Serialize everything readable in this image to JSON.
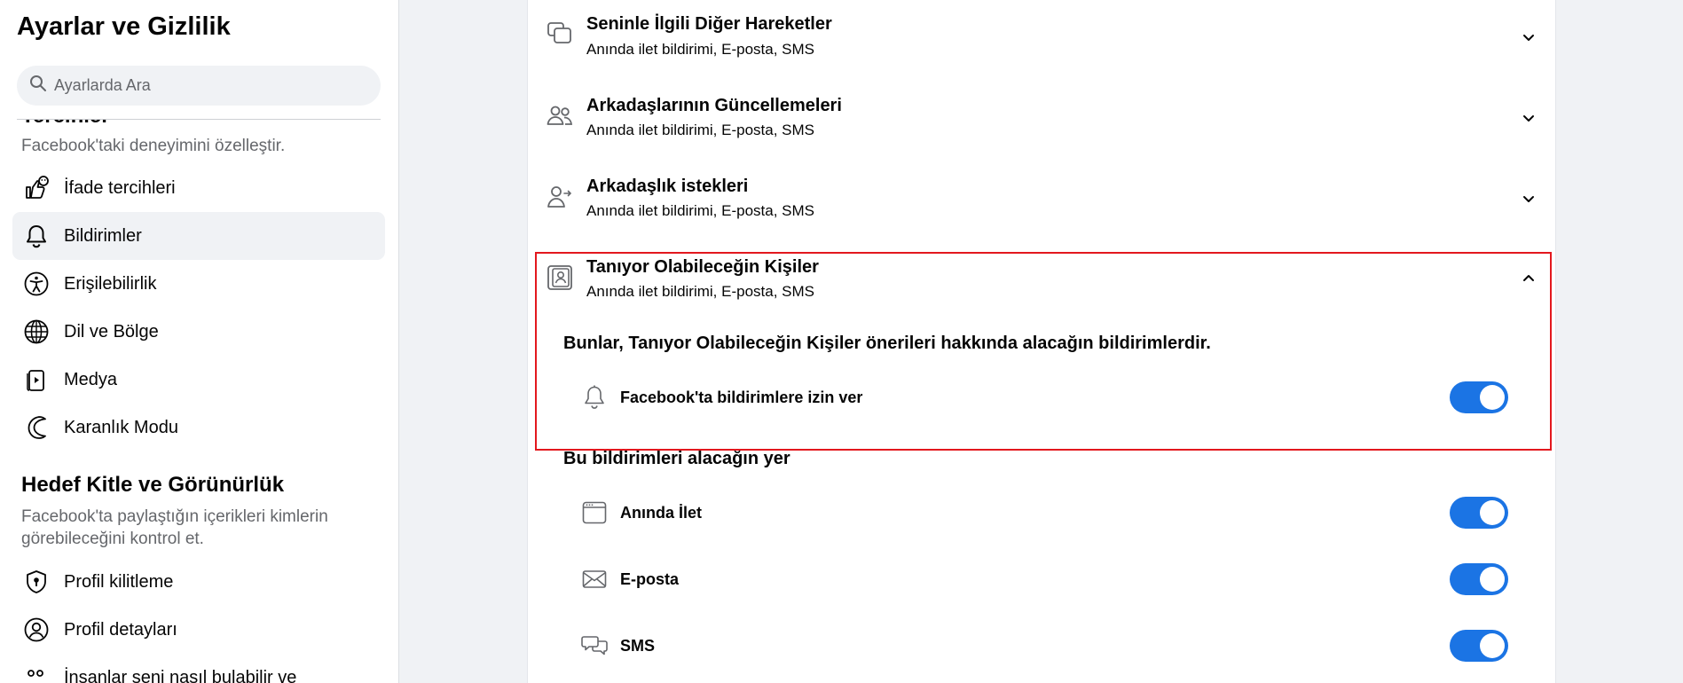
{
  "sidebar": {
    "title": "Ayarlar ve Gizlilik",
    "search_placeholder": "Ayarlarda Ara",
    "prefs_heading_partial": "Tercihler",
    "prefs_desc": "Facebook'taki deneyimini özelleştir.",
    "prefs_items": [
      {
        "label": "İfade tercihleri",
        "icon": "reactions-icon"
      },
      {
        "label": "Bildirimler",
        "icon": "bell-icon",
        "active": true
      },
      {
        "label": "Erişilebilirlik",
        "icon": "accessibility-icon"
      },
      {
        "label": "Dil ve Bölge",
        "icon": "globe-icon"
      },
      {
        "label": "Medya",
        "icon": "media-icon"
      },
      {
        "label": "Karanlık Modu",
        "icon": "moon-icon"
      }
    ],
    "audience_heading": "Hedef Kitle ve Görünürlük",
    "audience_desc": "Facebook'ta paylaştığın içerikleri kimlerin görebileceğini kontrol et.",
    "audience_items": [
      {
        "label": "Profil kilitleme",
        "icon": "shield-lock-icon"
      },
      {
        "label": "Profil detayları",
        "icon": "profile-icon"
      },
      {
        "label": "İnsanlar seni nasıl bulabilir ve",
        "icon": "people-search-icon"
      }
    ]
  },
  "main": {
    "rows": [
      {
        "title": "Seninle İlgili Diğer Hareketler",
        "sub": "Anında ilet bildirimi, E-posta, SMS",
        "icon": "chat-bubbles-icon",
        "expanded": false
      },
      {
        "title": "Arkadaşlarının Güncellemeleri",
        "sub": "Anında ilet bildirimi, E-posta, SMS",
        "icon": "friends-icon",
        "expanded": false
      },
      {
        "title": "Arkadaşlık istekleri",
        "sub": "Anında ilet bildirimi, E-posta, SMS",
        "icon": "friend-request-icon",
        "expanded": false
      },
      {
        "title": "Tanıyor Olabileceğin Kişiler",
        "sub": "Anında ilet bildirimi, E-posta, SMS",
        "icon": "contact-card-icon",
        "expanded": true
      }
    ],
    "explanation": "Bunlar, Tanıyor Olabileceğin Kişiler önerileri hakkında alacağın bildirimlerdir.",
    "allow_label": "Facebook'ta bildirimlere izin ver",
    "allow_on": true,
    "channels_heading": "Bu bildirimleri alacağın yer",
    "channels": [
      {
        "label": "Anında İlet",
        "icon": "browser-window-icon",
        "on": true
      },
      {
        "label": "E-posta",
        "icon": "envelope-icon",
        "on": true
      },
      {
        "label": "SMS",
        "icon": "sms-icon",
        "on": true
      }
    ]
  },
  "colors": {
    "accent": "#1b74e4",
    "highlight_border": "#e3181e",
    "background": "#f0f2f5"
  }
}
